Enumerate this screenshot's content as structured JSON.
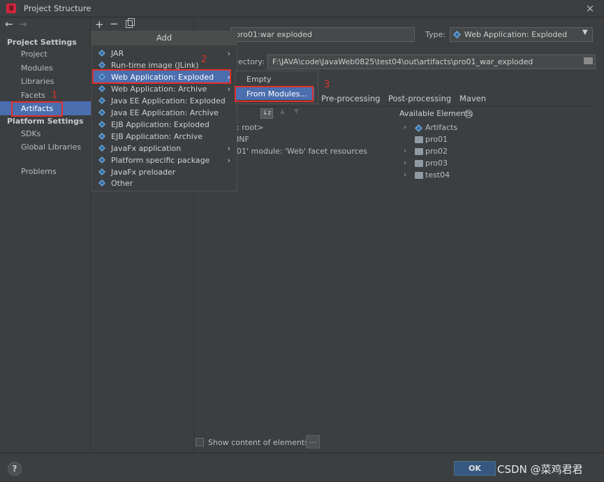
{
  "window": {
    "title": "Project Structure",
    "close": "×"
  },
  "nav": {
    "back": "←",
    "forward": "→"
  },
  "sidebar": {
    "project_settings": "Project Settings",
    "items": [
      "Project",
      "Modules",
      "Libraries",
      "Facets",
      "Artifacts"
    ],
    "platform_settings": "Platform Settings",
    "platform_items": [
      "SDKs",
      "Global Libraries"
    ],
    "problems": "Problems"
  },
  "toolbar": {
    "add": "+",
    "remove": "−"
  },
  "artifact": {
    "name_value": "pro01:war exploded",
    "type_label": "Type:",
    "type_value": "Web Application: Exploded",
    "dir_label": "ectory:",
    "dir_value": "F:\\JAVA\\code\\JavaWeb0825\\test04\\out\\artifacts\\pro01_war_exploded"
  },
  "tabs": [
    "Pre-processing",
    "Post-processing",
    "Maven"
  ],
  "output_tree": [
    ": root>",
    "INF",
    "01' module: 'Web' facet resources"
  ],
  "available": {
    "label": "Available Elements",
    "help": "?",
    "items": [
      "Artifacts",
      "pro01",
      "pro02",
      "pro03",
      "test04"
    ]
  },
  "add_menu": {
    "header": "Add",
    "items": [
      "JAR",
      "Run-time image (JLink)",
      "Web Application: Exploded",
      "Web Application: Archive",
      "Java EE Application: Exploded",
      "Java EE Application: Archive",
      "EJB Application: Exploded",
      "EJB Application: Archive",
      "JavaFx application",
      "Platform specific package",
      "JavaFx preloader",
      "Other"
    ]
  },
  "submenu": {
    "items": [
      "Empty",
      "From Modules..."
    ]
  },
  "annotations": [
    "1",
    "2",
    "3"
  ],
  "footer": {
    "show_content": "Show content of elements",
    "more": "...",
    "help": "?",
    "ok": "OK",
    "watermark": "CSDN @菜鸡君君"
  },
  "colors": {
    "accent": "#4b6eaf",
    "annotation": "#e0302c",
    "background": "#3c3f41"
  }
}
